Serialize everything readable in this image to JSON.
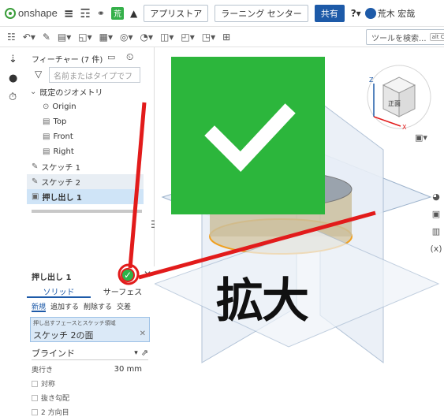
{
  "app": {
    "logo_text": "onshape",
    "doc_badge": "荒"
  },
  "topbar": {
    "app_store": "アプリストア",
    "learning_center": "ラーニング センター",
    "share": "共有",
    "user_name": "荒木 宏哉"
  },
  "toolbar": {
    "search_label": "ツールを検索...",
    "search_shortcut": "alt C"
  },
  "features": {
    "header": "フィーチャー (7 件)",
    "search_placeholder": "名前またはタイプでフ",
    "default_geometry": "既定のジオメトリ",
    "items": [
      {
        "label": "Origin"
      },
      {
        "label": "Top"
      },
      {
        "label": "Front"
      },
      {
        "label": "Right"
      },
      {
        "label": "スケッチ 1"
      },
      {
        "label": "スケッチ 2"
      },
      {
        "label": "押し出し 1"
      }
    ]
  },
  "dialog": {
    "title": "押し出し 1",
    "tab_solid": "ソリッド",
    "tab_surface": "サーフェス",
    "op_new": "新規",
    "op_add": "追加する",
    "op_remove": "削除する",
    "op_intersect": "交差",
    "faces_hint": "押し出すフェースとスケッチ領域",
    "faces_value": "スケッチ 2の面",
    "end_type": "ブラインド",
    "depth_label": "奥行き",
    "depth_value": "30 mm",
    "symmetric_label": "対称",
    "draft_label": "抜き勾配",
    "second_direction_label": "2 方向目"
  },
  "viewcube": {
    "top_label": "正面"
  },
  "annotation": {
    "text": "拡大"
  },
  "colors": {
    "accent": "#1d5aa8",
    "ok_green": "#2db34a",
    "annotation_red": "#e21b1b",
    "zoom_green": "#2cb63c"
  }
}
